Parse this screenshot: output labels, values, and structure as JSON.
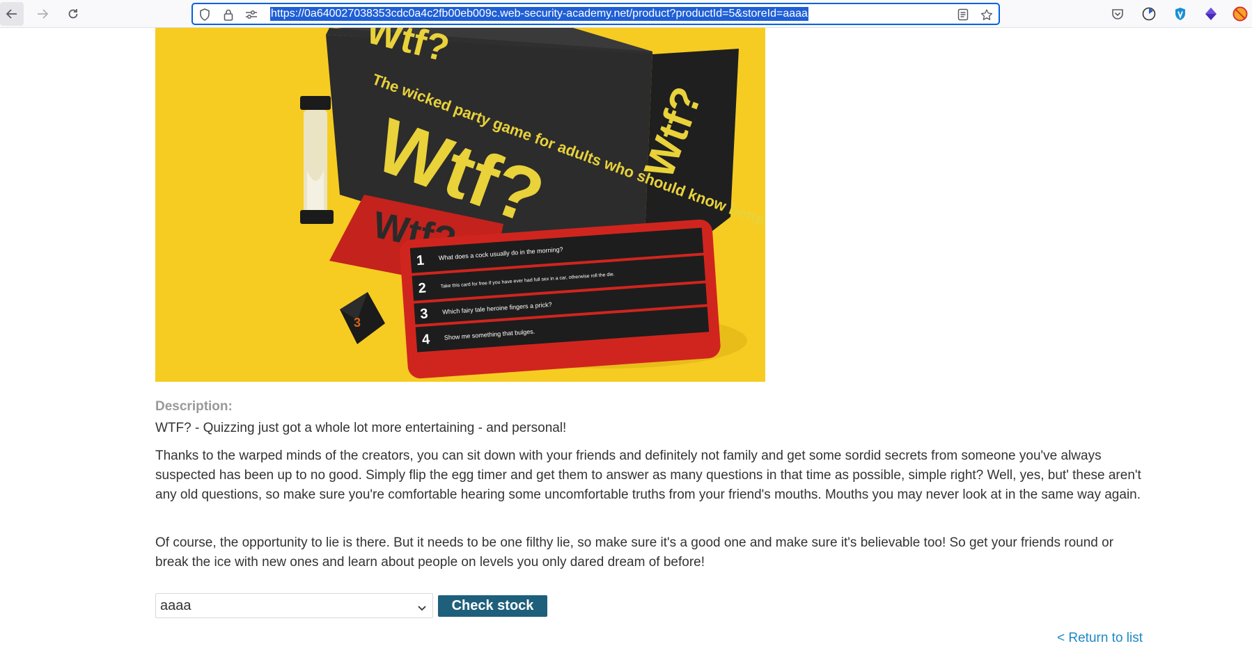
{
  "browser": {
    "url": "https://0a640027038353cdc0a4c2fb00eb009c.web-security-academy.net/product?productId=5&storeId=aaaa",
    "icons": [
      "back-arrow-icon",
      "forward-arrow-icon",
      "reload-icon",
      "shield-icon",
      "lock-icon",
      "permissions-icon",
      "reader-view-icon",
      "bookmark-star-icon",
      "pocket-icon",
      "clock-extension-icon",
      "vpn-extension-icon",
      "purple-extension-icon",
      "blocked-extension-icon"
    ]
  },
  "product": {
    "image_alt": "WTF? party game box with egg timer, cards and dice",
    "image_texts": {
      "box_top": "Wtf?",
      "box_tagline": "The wicked party game for adults who should know better",
      "box_big": "Wtf?",
      "box_side": "Wtf?",
      "card_title": "Wtf?",
      "q1": "What does a cock usually do in the morning?",
      "q2": "Take this card for free if you have ever had full sex in a car, otherwise roll the die.",
      "q3": "Which fairy tale heroine fingers a prick?",
      "q4": "Show me something that bulges."
    }
  },
  "description": {
    "label": "Description:",
    "paragraphs": [
      "WTF? - Quizzing just got a whole lot more entertaining - and personal!",
      "Thanks to the warped minds of the creators, you can sit down with your friends and definitely not family and get some sordid secrets from someone you've always suspected has been up to no good. Simply flip the egg timer and get them to answer as many questions in that time as possible, simple right? Well, yes, but' these aren't any old questions, so make sure you're comfortable hearing some uncomfortable truths from your friend's mouths. Mouths you may never look at in the same way again.",
      "Of course, the opportunity to lie is there. But it needs to be one filthy lie, so make sure it's a good one and make sure it's believable too! So get your friends round or break the ice with new ones and learn about people on levels you only dared dream of before!"
    ]
  },
  "stock_form": {
    "selected_store": "aaaa",
    "button_label": "Check stock"
  },
  "links": {
    "return": "< Return to list"
  },
  "colors": {
    "button_bg": "#1e5f7c",
    "link": "#1e88c6",
    "url_highlight": "#1f5fd6",
    "image_bg": "#f6cc22"
  }
}
